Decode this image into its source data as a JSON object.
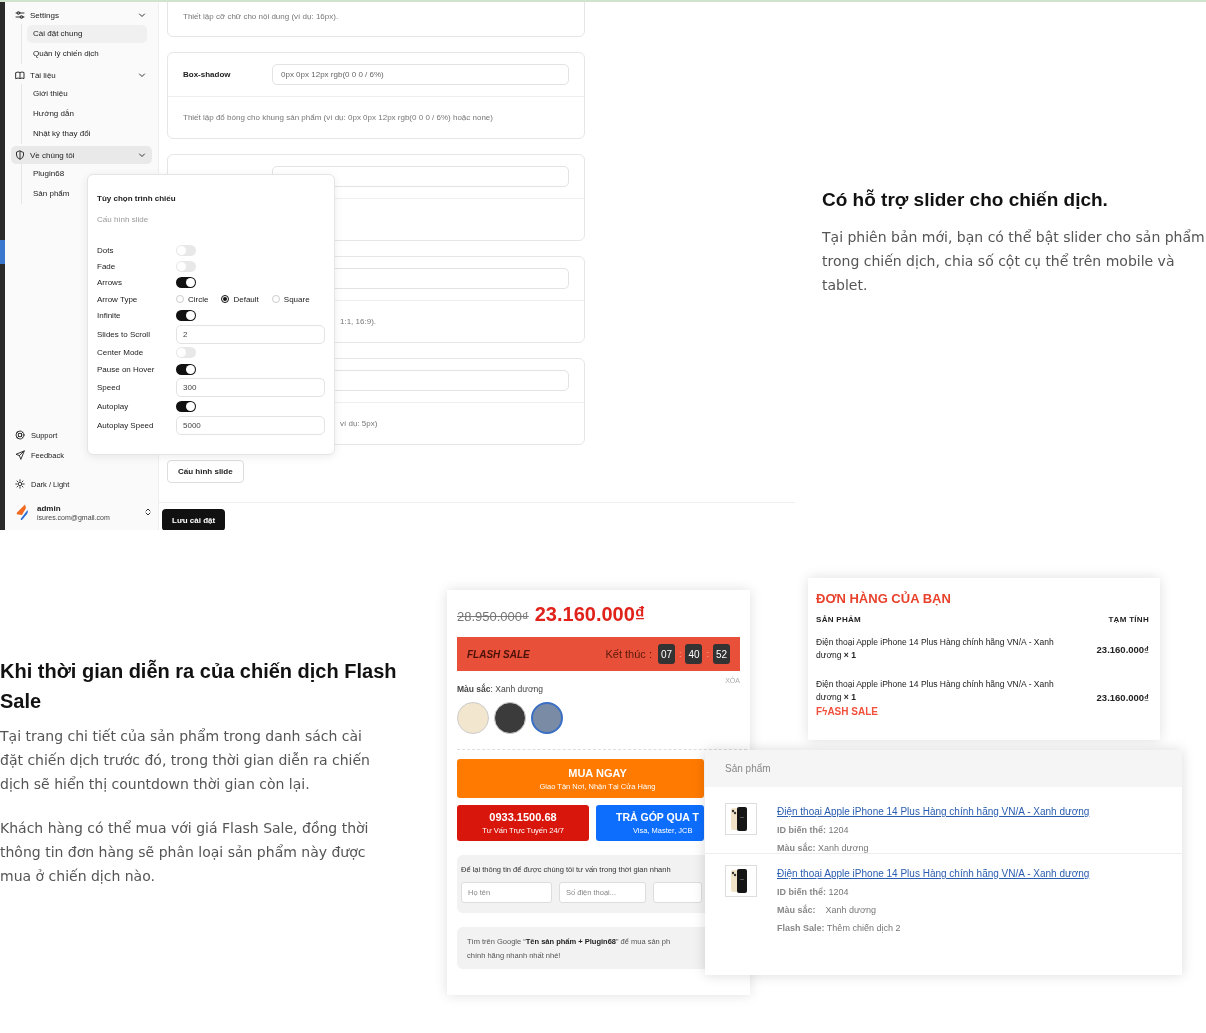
{
  "admin_screen": {
    "sidebar": {
      "sections": [
        {
          "label": "Settings",
          "expanded": true,
          "selected": false,
          "children": [
            {
              "label": "Cài đặt chung",
              "selected": true
            },
            {
              "label": "Quản lý chiến dịch",
              "selected": false
            }
          ]
        },
        {
          "label": "Tài liệu",
          "expanded": true,
          "selected": false,
          "children": [
            {
              "label": "Giới thiệu",
              "selected": false
            },
            {
              "label": "Hướng dẫn",
              "selected": false
            },
            {
              "label": "Nhật ký thay đổi",
              "selected": false
            }
          ]
        },
        {
          "label": "Về chúng tôi",
          "expanded": true,
          "selected": true,
          "children": [
            {
              "label": "Plugin68",
              "selected": false
            },
            {
              "label": "Sản phẩm",
              "selected": false
            }
          ]
        }
      ],
      "footer_links": [
        {
          "label": "Support"
        },
        {
          "label": "Feedback"
        }
      ],
      "theme_toggle": "Dark / Light",
      "user": {
        "name": "admin",
        "email": "isures.com@gmail.com"
      }
    },
    "settings_cards": [
      {
        "kind": "note",
        "description": "Thiết lập cỡ chữ cho nội dung (ví dụ: 16px)."
      },
      {
        "kind": "field",
        "label": "Box-shadow",
        "value": "0px 0px 12px rgb(0 0 0 / 6%)",
        "description": "Thiết lập đổ bóng cho khung sản phẩm (ví dụ: 0px 0px 12px rgb(0 0 0 / 6%) hoặc none)"
      },
      {
        "kind": "covered"
      },
      {
        "kind": "covered",
        "description": "1:1, 16:9)."
      },
      {
        "kind": "covered",
        "description": "ví dụ: 5px)"
      }
    ],
    "slide_button": "Cấu hình slide",
    "save_button": "Lưu cài đặt",
    "popover": {
      "title": "Tùy chọn trình chiếu",
      "subtitle": "Cấu hình slide",
      "options": [
        {
          "kind": "toggle",
          "label": "Dots",
          "on": false
        },
        {
          "kind": "toggle",
          "label": "Fade",
          "on": false
        },
        {
          "kind": "toggle",
          "label": "Arrows",
          "on": true
        },
        {
          "kind": "radio",
          "label": "Arrow Type",
          "choices": [
            {
              "label": "Circle",
              "selected": false
            },
            {
              "label": "Default",
              "selected": true
            },
            {
              "label": "Square",
              "selected": false
            }
          ]
        },
        {
          "kind": "toggle",
          "label": "Infinite",
          "on": true
        },
        {
          "kind": "input",
          "label": "Slides to Scroll",
          "value": "2"
        },
        {
          "kind": "toggle",
          "label": "Center Mode",
          "on": false
        },
        {
          "kind": "toggle",
          "label": "Pause on Hover",
          "on": true
        },
        {
          "kind": "input",
          "label": "Speed",
          "value": "300"
        },
        {
          "kind": "toggle",
          "label": "Autoplay",
          "on": true
        },
        {
          "kind": "input",
          "label": "Autoplay Speed",
          "value": "5000"
        }
      ]
    }
  },
  "slider_feature": {
    "heading": "Có hỗ trợ slider cho chiến dịch.",
    "paragraphs": [
      "Tại phiên bản mới, bạn có thể bật slider cho sản phẩm trong chiến dịch, chia số cột cụ thể trên mobile và tablet."
    ]
  },
  "flash_sale_feature": {
    "heading": "Khi thời gian diễn ra của chiến dịch Flash Sale",
    "paragraphs": [
      "Tại trang chi tiết của sản phẩm trong danh sách cài đặt chiến dịch trước đó, trong thời gian diễn ra chiến dịch sẽ hiển thị countdown thời gian còn lại.",
      "Khách hàng có thể mua với giá Flash Sale, đồng thời thông tin đơn hàng sẽ phân loại sản phẩm này được mua ở chiến dịch nào."
    ]
  },
  "product_page": {
    "old_price": "28.950.000₫",
    "price": "23.160.000₫",
    "flash_bar": {
      "label": "FLASH SALE",
      "countdown": [
        {
          "kind": "label",
          "text": "Kết thúc :"
        },
        {
          "kind": "digits",
          "text": "07"
        },
        {
          "kind": "sep",
          "text": ":"
        },
        {
          "kind": "digits",
          "text": "40"
        },
        {
          "kind": "sep",
          "text": ":"
        },
        {
          "kind": "digits",
          "text": "52"
        }
      ]
    },
    "clear_link": "XÓA",
    "color_label": "**Màu sắc**: Xanh dương",
    "swatches": [
      {
        "color": "#f3e6cf",
        "selected": false
      },
      {
        "color": "#3b3b3b",
        "selected": false
      },
      {
        "color": "#7a8ba6",
        "selected": true
      }
    ],
    "buy_button": {
      "title": "MUA NGAY",
      "subtitle": "Giao Tận Nơi, Nhận Tại Cửa Hàng"
    },
    "call_button": {
      "title": "0933.1500.68",
      "subtitle": "Tư Vấn Trực Tuyến 24/7"
    },
    "installment_button": {
      "title": "TRẢ GÓP QUA T",
      "subtitle": "Visa, Master, JCB"
    },
    "contact_form": {
      "prompt": "Để lại thông tin để được chúng tôi tư vấn trong thời gian nhanh",
      "fields": [
        {
          "kind": "text",
          "placeholder": "Họ tên"
        },
        {
          "kind": "text",
          "placeholder": "Số điện thoại..."
        },
        {
          "kind": "blank"
        }
      ]
    },
    "note": "Tìm trên Google “**Tên sản phẩm + Plugin68**” để mua sản ph\nchính hãng nhanh nhất nhé!"
  },
  "order_summary": {
    "title": "ĐƠN HÀNG CỦA BẠN",
    "columns": [
      "SẢN PHẨM",
      "TẠM TÍNH"
    ],
    "items": [
      {
        "name": "Điện thoại Apple iPhone 14 Plus Hàng chính hãng VN/A - Xanh dương  **× 1**",
        "price": "23.160.000₫"
      },
      {
        "name": "Điện thoại Apple iPhone 14 Plus Hàng chính hãng VN/A - Xanh dương  **× 1**",
        "price": "23.160.000₫",
        "badge": "FϟASH SALE"
      }
    ]
  },
  "product_list": {
    "header": "Sản phẩm",
    "rows": [
      {
        "link": "Điện thoại Apple iPhone 14 Plus Hàng chính hãng VN/A - Xanh dương",
        "details": [
          "**ID biến thể:** 1204",
          "**Màu sắc:** Xanh dương"
        ]
      },
      {
        "link": "Điện thoại Apple iPhone 14 Plus Hàng chính hãng VN/A - Xanh dương",
        "details": [
          "**ID biến thể:** 1204",
          "**Màu sắc:**    Xanh dương",
          "**Flash Sale:** Thêm chiến dịch 2"
        ]
      }
    ]
  }
}
